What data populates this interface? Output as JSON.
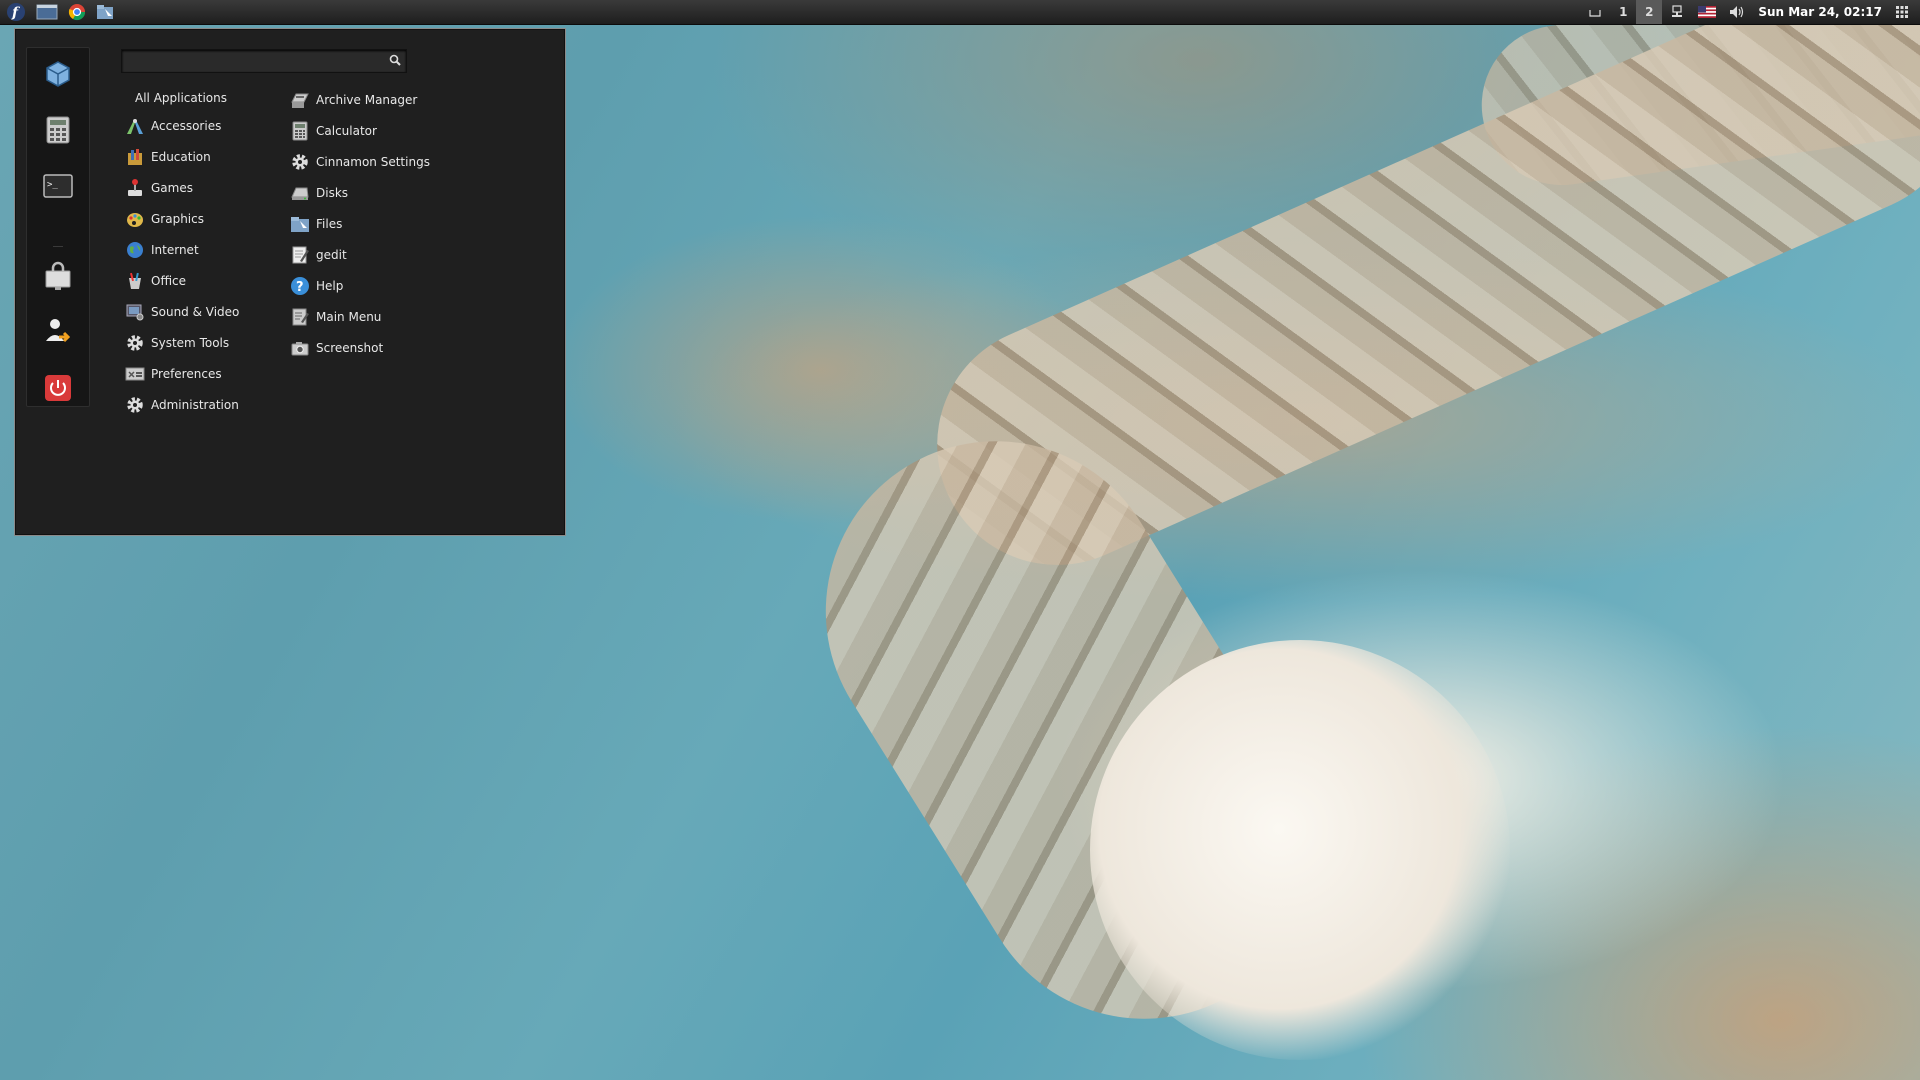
{
  "panel": {
    "workspaces": [
      "1",
      "2"
    ],
    "active_workspace": "2",
    "clock": "Sun Mar 24, 02:17",
    "launchers": [
      "fedora-logo-icon",
      "show-desktop-icon",
      "chrome-icon",
      "files-icon"
    ]
  },
  "menu": {
    "search": {
      "value": "",
      "placeholder": ""
    },
    "favorites": [
      "virtualbox-icon",
      "calculator-icon",
      "terminal-icon",
      "lock-screen-icon",
      "logout-icon",
      "power-icon"
    ],
    "categories": [
      {
        "label": "All Applications",
        "icon": ""
      },
      {
        "label": "Accessories",
        "icon": "accessories-icon"
      },
      {
        "label": "Education",
        "icon": "education-icon"
      },
      {
        "label": "Games",
        "icon": "games-icon"
      },
      {
        "label": "Graphics",
        "icon": "graphics-icon"
      },
      {
        "label": "Internet",
        "icon": "internet-icon"
      },
      {
        "label": "Office",
        "icon": "office-icon"
      },
      {
        "label": "Sound & Video",
        "icon": "sound-video-icon"
      },
      {
        "label": "System Tools",
        "icon": "system-tools-icon"
      },
      {
        "label": "Preferences",
        "icon": "preferences-icon"
      },
      {
        "label": "Administration",
        "icon": "administration-icon"
      }
    ],
    "apps": [
      {
        "label": "Archive Manager",
        "icon": "archive-manager-icon"
      },
      {
        "label": "Calculator",
        "icon": "calculator-icon"
      },
      {
        "label": "Cinnamon Settings",
        "icon": "settings-gear-icon"
      },
      {
        "label": "Disks",
        "icon": "disks-icon"
      },
      {
        "label": "Files",
        "icon": "files-icon"
      },
      {
        "label": "gedit",
        "icon": "gedit-icon"
      },
      {
        "label": "Help",
        "icon": "help-icon"
      },
      {
        "label": "Main Menu",
        "icon": "menu-editor-icon"
      },
      {
        "label": "Screenshot",
        "icon": "screenshot-icon"
      }
    ]
  },
  "colors": {
    "panel": "#2a2a2a",
    "menu_bg": "#1f1f1f",
    "accent_red": "#d93a3a",
    "help_blue": "#3a8fd9"
  }
}
